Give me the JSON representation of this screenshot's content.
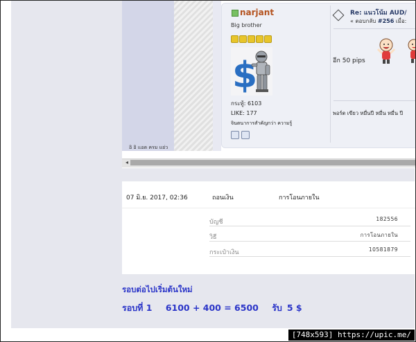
{
  "forum": {
    "sidebar_text": "อิ อิ แอด ครม แย่ว",
    "username": "narjant",
    "rank": "Big brother",
    "star_count": 5,
    "posts": "กระทู้: 6103",
    "likes": "LIKE: 177",
    "signature": "จินตนาการสำคัญกว่า ความรู้",
    "topic_title": "Re: แนวโน้ม AUD/",
    "reply_prefix": "« ตอบกลับ",
    "reply_no": "#256",
    "reply_suffix": "เมื่อ:",
    "post_text": "อีก  50 pips",
    "post_footer": "พอร์ต  เขียว  หมื่นปี  หมื่น  หมื่น  ปี",
    "scroll_left_arrow": "◂",
    "colors": {
      "username": "#b4521e",
      "online": "#77c062",
      "star": "#e8c52a"
    }
  },
  "statement": {
    "date": "07 มิ.ย. 2017, 02:36",
    "operation": "ถอนเงิน",
    "type": "การโอนภายใน",
    "details": [
      {
        "label": "บัญชี",
        "value": "182556"
      },
      {
        "label": "วิธี",
        "value": "การโอนภายใน"
      },
      {
        "label": "กระเป๋าเงิน",
        "value": "10581879"
      }
    ]
  },
  "round": {
    "next_text": "รอบต่อไปเริ่มต้นใหม่",
    "round_label": "รอบที่ 1",
    "calc": "6100 + 400 = 6500",
    "reward_label": "รับ",
    "reward_value": "5 $",
    "color": "#2b35c8"
  },
  "footer": {
    "badge": "[748x593] https://upic.me/"
  }
}
